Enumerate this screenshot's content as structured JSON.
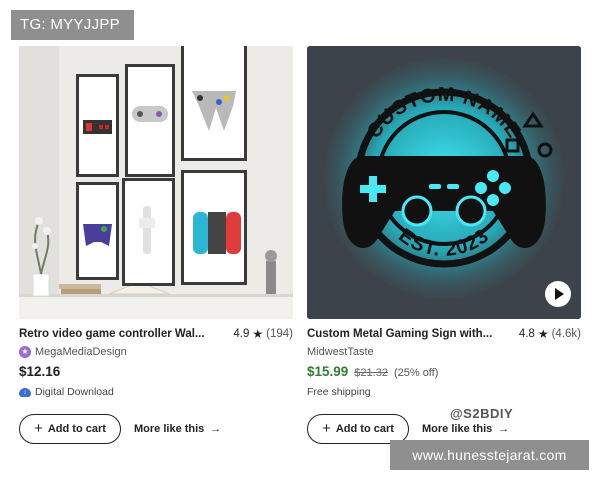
{
  "tg_badge": "TG: MYYJJPP",
  "products": [
    {
      "title": "Retro video game controller Wal...",
      "rating": "4.9",
      "reviews": "(194)",
      "shop": "MegaMediaDesign",
      "price": "$12.16",
      "original_price": "",
      "discount": "",
      "subtext": "Digital Download",
      "add_to_cart": "Add to cart",
      "more_like_this": "More like this"
    },
    {
      "title": "Custom Metal Gaming Sign with...",
      "rating": "4.8",
      "reviews": "(4.6k)",
      "shop": "MidwestTaste",
      "price": "$15.99",
      "original_price": "$21.32",
      "discount": "(25% off)",
      "subtext": "Free shipping",
      "add_to_cart": "Add to cart",
      "more_like_this": "More like this",
      "sign_text_top": "CUSTOM NAME",
      "sign_text_bottom": "EST. 2023"
    }
  ],
  "watermark_overlay": "@S2BDIY",
  "footer_badge": "www.hunesstejarat.com",
  "colors": {
    "sale_price": "#2e7d32",
    "sign_glow": "#1ee0f0",
    "shop_badge": "#9a6ad6",
    "download_icon": "#3a6fcf"
  },
  "icons": [
    "star-icon",
    "shop-badge-icon",
    "digital-download-icon",
    "plus-icon",
    "arrow-right-icon",
    "play-icon"
  ]
}
